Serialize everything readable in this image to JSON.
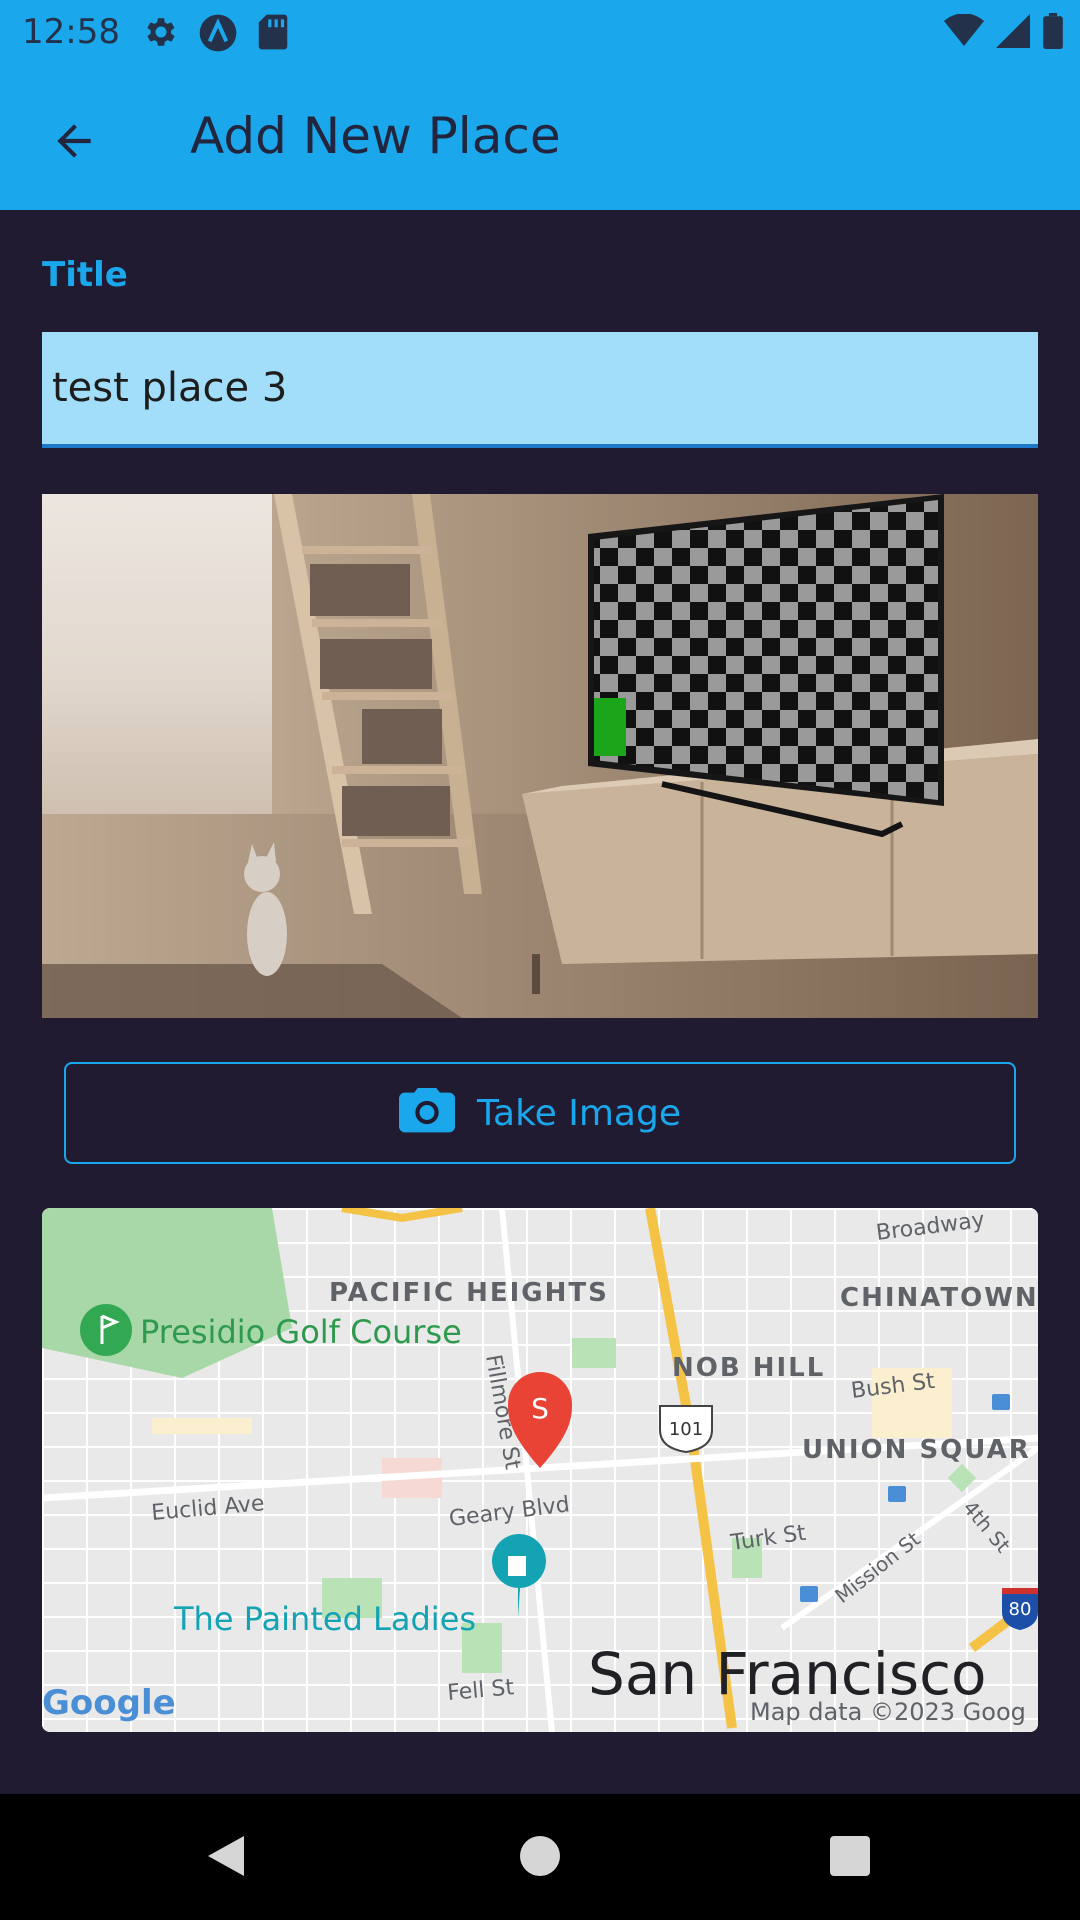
{
  "status_bar": {
    "time": "12:58",
    "icons_left": [
      "settings-icon",
      "app-a-icon",
      "sd-card-icon"
    ],
    "icons_right": [
      "wifi-icon",
      "signal-icon",
      "battery-icon"
    ]
  },
  "app_bar": {
    "title": "Add New Place",
    "back_icon": "arrow-back-icon"
  },
  "form": {
    "title_label": "Title",
    "title_value": "test place 3"
  },
  "image_preview": {
    "description": "room-with-tv-and-cat"
  },
  "take_image_button": {
    "label": "Take Image",
    "icon": "camera-icon"
  },
  "map": {
    "labels": {
      "broadway": "Broadway",
      "pacific_heights": "PACIFIC HEIGHTS",
      "chinatown": "CHINATOWN",
      "presidio": "Presidio Golf Course",
      "nob_hill": "NOB HILL",
      "bush": "Bush St",
      "fillmore": "Fillmore St",
      "hwy101": "101",
      "union_square": "UNION SQUAR",
      "euclid": "Euclid Ave",
      "geary": "Geary Blvd",
      "turk": "Turk St",
      "mission": "Mission St",
      "fourth": "4th St",
      "hwy80": "80",
      "painted_ladies": "The Painted Ladies",
      "fell": "Fell St",
      "san_francisco": "San Francisco",
      "google": "Google",
      "attribution": "Map data ©2023 Goog",
      "pin_letter": "S"
    }
  },
  "nav_bar": {
    "back": "nav-back-icon",
    "home": "nav-home-icon",
    "recents": "nav-recents-icon"
  },
  "colors": {
    "accent": "#1aa7eb",
    "background": "#211b31",
    "input_fill": "#a2def9",
    "pin": "#e84335"
  }
}
